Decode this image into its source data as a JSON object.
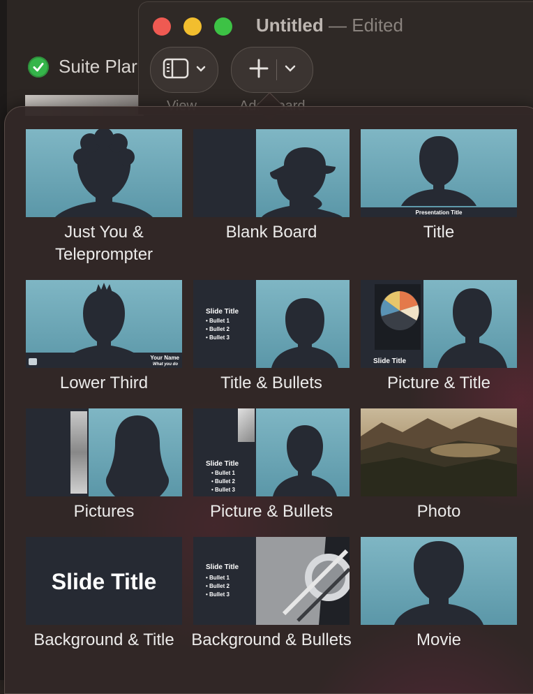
{
  "background_window": {
    "item_label": "Suite Plar"
  },
  "window": {
    "title": "Untitled",
    "separator": "—",
    "status": "Edited"
  },
  "toolbar": {
    "view_label": "View",
    "add_label": "Add Board"
  },
  "layouts": [
    {
      "label": "Just You & Teleprompter"
    },
    {
      "label": "Blank Board"
    },
    {
      "label": "Title",
      "caption": "Presentation Title"
    },
    {
      "label": "Lower Third",
      "name_text": "Your Name",
      "sub_text": "What you do"
    },
    {
      "label": "Title & Bullets",
      "slide_title": "Slide Title",
      "bullets": [
        "• Bullet 1",
        "• Bullet 2",
        "• Bullet 3"
      ]
    },
    {
      "label": "Picture & Title",
      "slide_title": "Slide Title"
    },
    {
      "label": "Pictures"
    },
    {
      "label": "Picture & Bullets",
      "slide_title": "Slide Title",
      "bullets": [
        "• Bullet 1",
        "• Bullet 2",
        "• Bullet 3"
      ]
    },
    {
      "label": "Photo"
    },
    {
      "label": "Background & Title",
      "slide_title": "Slide Title"
    },
    {
      "label": "Background & Bullets",
      "slide_title": "Slide Title",
      "bullets": [
        "• Bullet 1",
        "• Bullet 2",
        "• Bullet 3"
      ]
    },
    {
      "label": "Movie"
    }
  ],
  "colors": {
    "accent_green": "#35b54a",
    "thumb_sky": "#7fb6c4",
    "silhouette": "#262a33"
  }
}
